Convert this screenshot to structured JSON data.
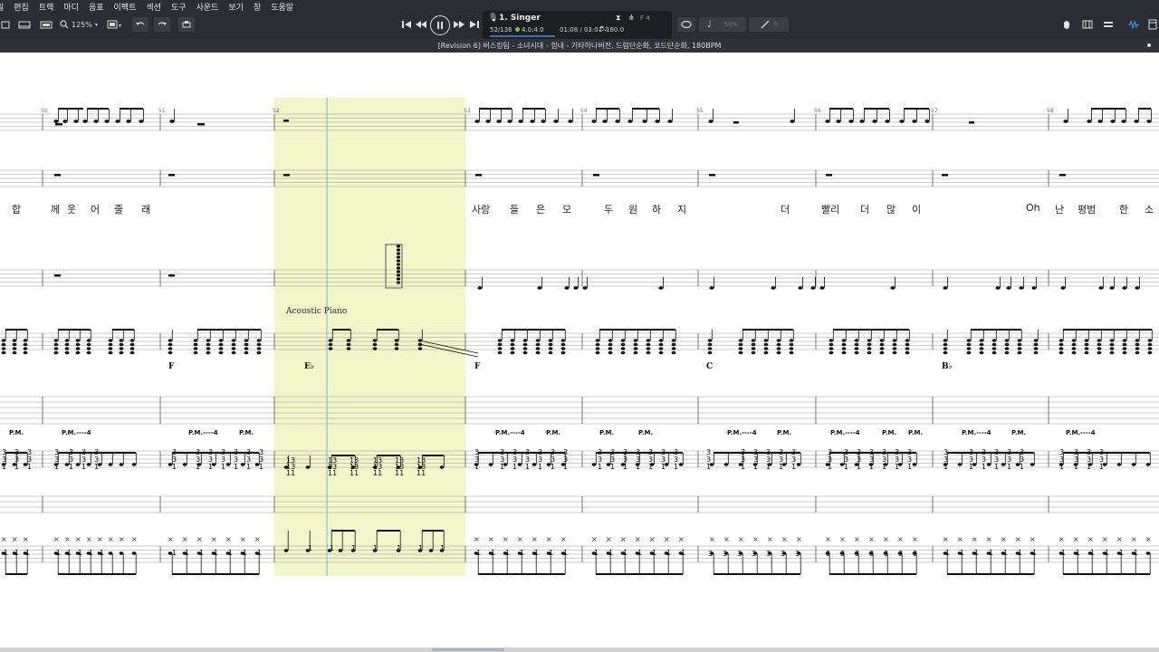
{
  "menu": [
    "일",
    "편집",
    "트랙",
    "마디",
    "음표",
    "이펙트",
    "섹션",
    "도구",
    "사운드",
    "보기",
    "창",
    "도움말"
  ],
  "toolbar": {
    "zoom": "125%"
  },
  "lcd": {
    "track_name": "1. Singer",
    "position": "52/136",
    "time_signature": "4.0:4.0",
    "time": "01:08 / 03:01",
    "tempo": "180.0",
    "key": "F 4"
  },
  "document_title": "[Revision 6] 버스킹팀 - 소녀시대 - 힘내 - 기타하나버전, 드럼단순화, 코드단순화, 180BPM",
  "score": {
    "bar_numbers": [
      "50",
      "51",
      "52",
      "53",
      "54",
      "55",
      "56",
      "57",
      "58"
    ],
    "lyrics": [
      {
        "text": "합"
      },
      {
        "text": "께"
      },
      {
        "text": "웃"
      },
      {
        "text": "어"
      },
      {
        "text": "줄"
      },
      {
        "text": "래"
      },
      {
        "text": "사랑"
      },
      {
        "text": "들"
      },
      {
        "text": "은"
      },
      {
        "text": "모"
      },
      {
        "text": "두"
      },
      {
        "text": "원"
      },
      {
        "text": "하"
      },
      {
        "text": "지"
      },
      {
        "text": "더"
      },
      {
        "text": "빨리"
      },
      {
        "text": "더"
      },
      {
        "text": "많"
      },
      {
        "text": "이"
      },
      {
        "text": "Oh"
      },
      {
        "text": "난"
      },
      {
        "text": "평범"
      },
      {
        "text": "한"
      },
      {
        "text": "소"
      }
    ],
    "instrument_label": "Acoustic Piano",
    "chords": [
      "F",
      "E♭",
      "F",
      "C",
      "B♭"
    ],
    "pm_label": "P.M.",
    "pm_dashed": "P.M.----4"
  },
  "colors": {
    "chrome_bg": "#2a2d31",
    "highlight": "#f3f6c8",
    "cursor": "#7fb8d8",
    "accent": "#3a6fb0"
  }
}
